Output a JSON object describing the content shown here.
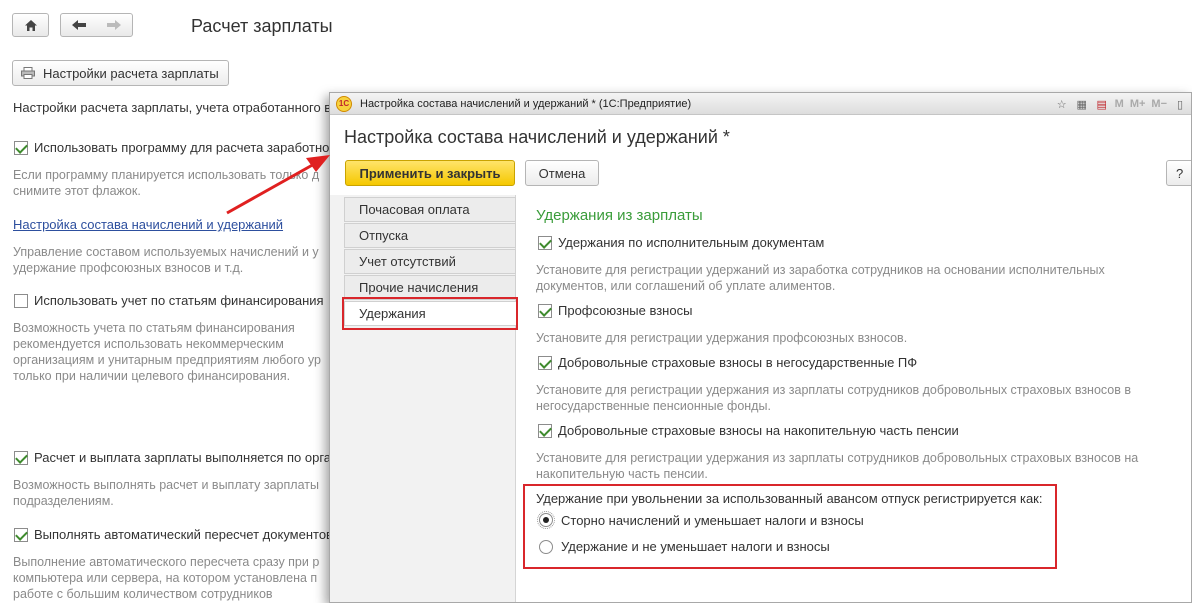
{
  "background": {
    "nav": {
      "home_icon": "home-icon",
      "back_icon": "arrow-left-icon",
      "forward_icon": "arrow-right-icon"
    },
    "title": "Расчет зарплаты",
    "settings_button": "Настройки расчета зарплаты",
    "settings_icon": "printer-icon",
    "intro": "Настройки расчета зарплаты, учета отработанного в",
    "use_program": {
      "label": "Использовать программу для расчета заработно",
      "checked": true,
      "hint_lines": [
        "Если программу планируется использовать только д",
        "снимите этот флажок."
      ]
    },
    "link": "Настройка состава начислений и удержаний",
    "link_hint_lines": [
      "Управление составом используемых начислений и у",
      "удержание профсоюзных взносов и т.д."
    ],
    "financing": {
      "label": "Использовать учет по статьям финансирования",
      "checked": false,
      "hint_lines": [
        "Возможность учета по статьям финансирования",
        "рекомендуется использовать некоммерческим",
        "организациям и унитарным предприятиям любого ур",
        "только при наличии целевого финансирования."
      ]
    },
    "payout": {
      "label": "Расчет и выплата зарплаты выполняется по орга",
      "checked": true,
      "hint_lines": [
        "Возможность выполнять расчет и выплату зарплаты",
        "подразделениям."
      ]
    },
    "recalc": {
      "label": "Выполнять автоматический пересчет документов",
      "checked": true,
      "hint_lines": [
        "Выполнение автоматического пересчета сразу при р",
        "компьютера или сервера, на котором установлена п",
        "работе с большим количеством сотрудников"
      ]
    }
  },
  "modal": {
    "window_title": "Настройка состава начислений и удержаний * (1С:Предприятие)",
    "heading": "Настройка состава начислений и удержаний *",
    "apply_button": "Применить и закрыть",
    "cancel_button": "Отмена",
    "help_button": "?",
    "titlebar_m": [
      "M",
      "M+",
      "M−"
    ],
    "sidebar": [
      {
        "label": "Почасовая оплата",
        "active": false
      },
      {
        "label": "Отпуска",
        "active": false
      },
      {
        "label": "Учет отсутствий",
        "active": false
      },
      {
        "label": "Прочие начисления",
        "active": false
      },
      {
        "label": "Удержания",
        "active": true
      }
    ],
    "section_title": "Удержания из зарплаты",
    "options": [
      {
        "label": "Удержания по исполнительным документам",
        "checked": true,
        "hint_lines": [
          "Установите для регистрации удержаний из заработка сотрудников на основании исполнительных",
          "документов, или соглашений об уплате алиментов."
        ]
      },
      {
        "label": "Профсоюзные взносы",
        "checked": true,
        "hint_lines": [
          "Установите для регистрации удержания профсоюзных взносов."
        ]
      },
      {
        "label": "Добровольные страховые взносы в негосударственные ПФ",
        "checked": true,
        "hint_lines": [
          "Установите для регистрации удержания из зарплаты сотрудников добровольных страховых взносов в",
          "негосударственные пенсионные фонды."
        ]
      },
      {
        "label": "Добровольные страховые взносы на накопительную часть пенсии",
        "checked": true,
        "hint_lines": [
          "Установите для регистрации удержания из зарплаты сотрудников добровольных страховых взносов на",
          "накопительную часть пенсии."
        ]
      }
    ],
    "radio_caption": "Удержание при увольнении за использованный авансом отпуск регистрируется как:",
    "radio_options": [
      {
        "label": "Сторно начислений и уменьшает налоги и взносы",
        "selected": true
      },
      {
        "label": "Удержание и не уменьшает налоги и взносы",
        "selected": false
      }
    ]
  },
  "colors": {
    "accent_yellow": "#f5c800",
    "section_green": "#3a9c3a",
    "highlight_red": "#d9262b",
    "link_blue": "#2d4f9e"
  }
}
